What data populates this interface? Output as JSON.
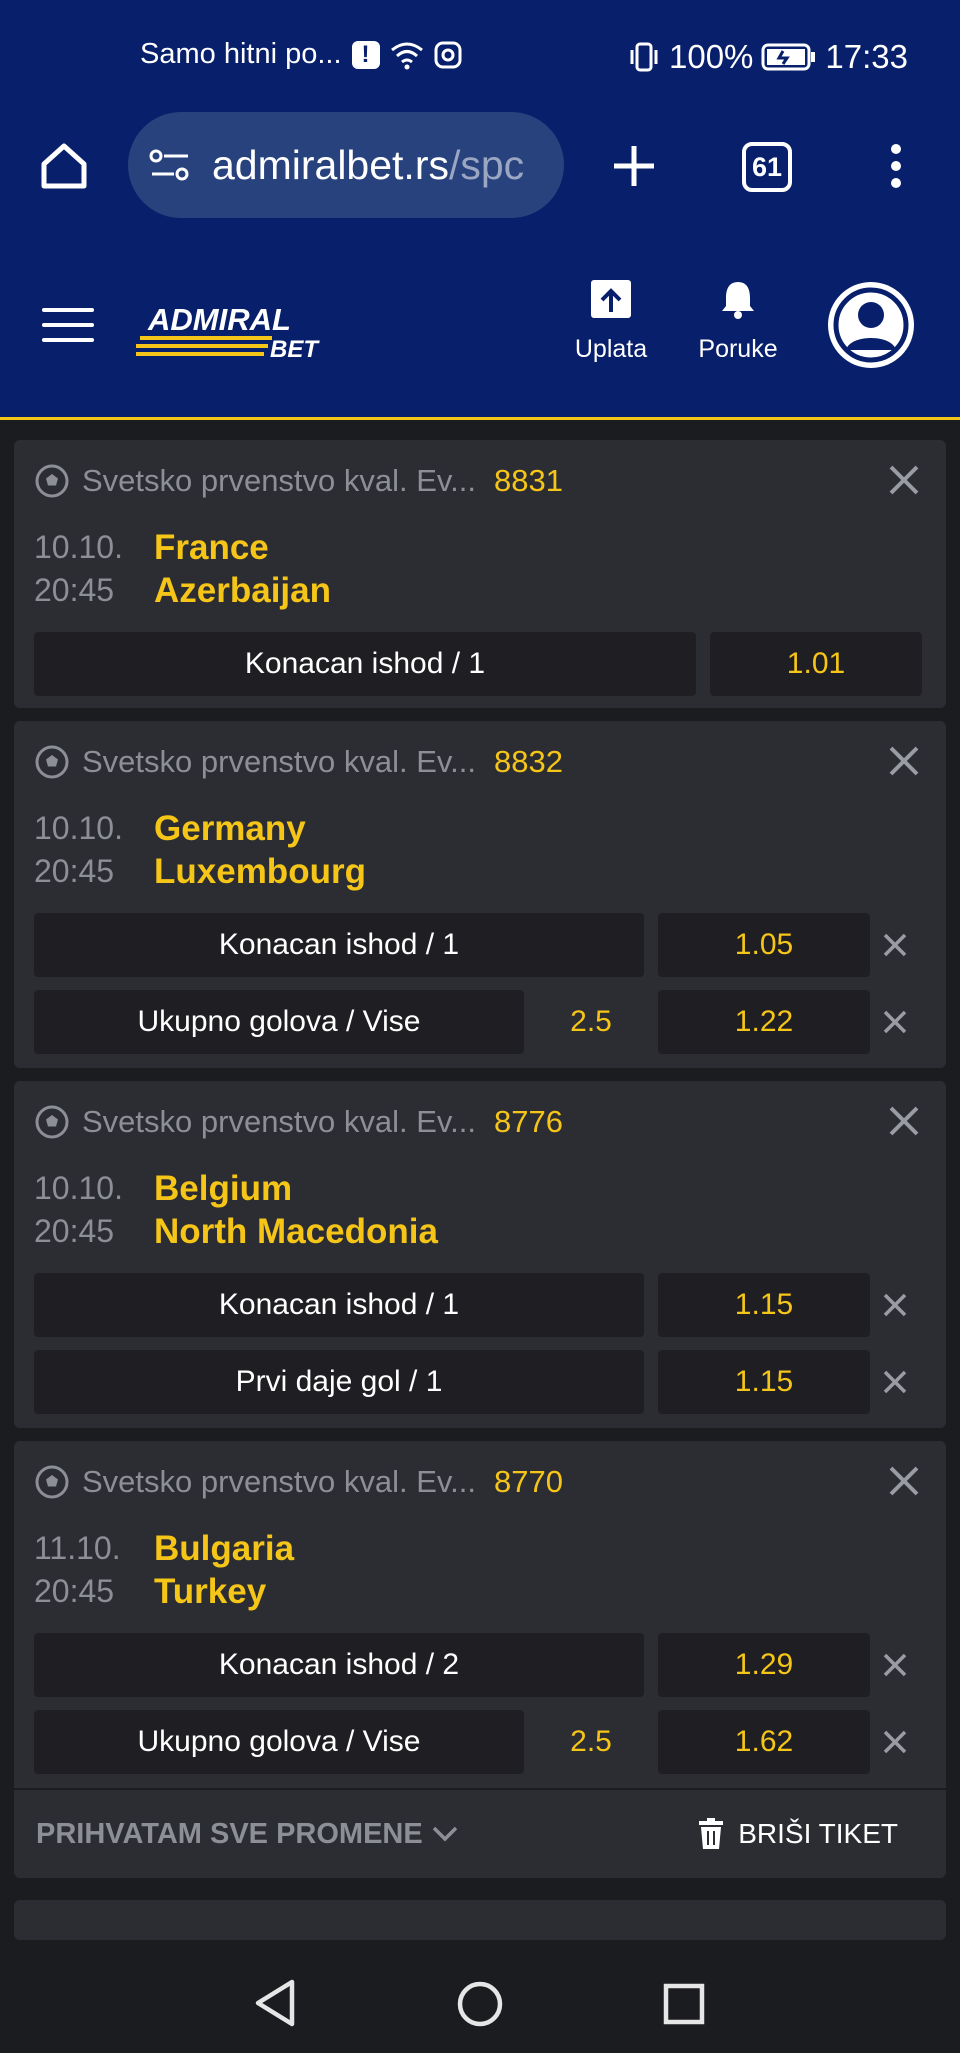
{
  "status_bar": {
    "notification": "Samo hitni po...",
    "battery": "100%",
    "time": "17:33"
  },
  "browser": {
    "url_host": "admiralbet.rs",
    "url_rest": "/spc",
    "tab_count": "61"
  },
  "header": {
    "logo_top": "ADMIRAL",
    "logo_bottom": "BET",
    "deposit_label": "Uplata",
    "messages_label": "Poruke"
  },
  "bets": [
    {
      "league": "Svetsko prvenstvo kval. Ev...",
      "code": "8831",
      "date": "10.10.",
      "time": "20:45",
      "home": "France",
      "away": "Azerbaijan",
      "selections": [
        {
          "pick": "Konacan ishod / 1",
          "value": "",
          "odd": "1.01"
        }
      ]
    },
    {
      "league": "Svetsko prvenstvo kval. Ev...",
      "code": "8832",
      "date": "10.10.",
      "time": "20:45",
      "home": "Germany",
      "away": "Luxembourg",
      "selections": [
        {
          "pick": "Konacan ishod / 1",
          "value": "",
          "odd": "1.05"
        },
        {
          "pick": "Ukupno golova / Vise",
          "value": "2.5",
          "odd": "1.22"
        }
      ]
    },
    {
      "league": "Svetsko prvenstvo kval. Ev...",
      "code": "8776",
      "date": "10.10.",
      "time": "20:45",
      "home": "Belgium",
      "away": "North Macedonia",
      "selections": [
        {
          "pick": "Konacan ishod / 1",
          "value": "",
          "odd": "1.15"
        },
        {
          "pick": "Prvi daje gol / 1",
          "value": "",
          "odd": "1.15"
        }
      ]
    },
    {
      "league": "Svetsko prvenstvo kval. Ev...",
      "code": "8770",
      "date": "11.10.",
      "time": "20:45",
      "home": "Bulgaria",
      "away": "Turkey",
      "selections": [
        {
          "pick": "Konacan ishod / 2",
          "value": "",
          "odd": "1.29"
        },
        {
          "pick": "Ukupno golova / Vise",
          "value": "2.5",
          "odd": "1.62"
        }
      ]
    }
  ],
  "footer": {
    "accept_label": "PRIHVATAM SVE PROMENE",
    "delete_label": "BRIŠI TIKET"
  },
  "colors": {
    "brand_blue": "#08206b",
    "accent_yellow": "#f5c518",
    "card_bg": "#2c2d32",
    "page_bg": "#1b1c20"
  }
}
